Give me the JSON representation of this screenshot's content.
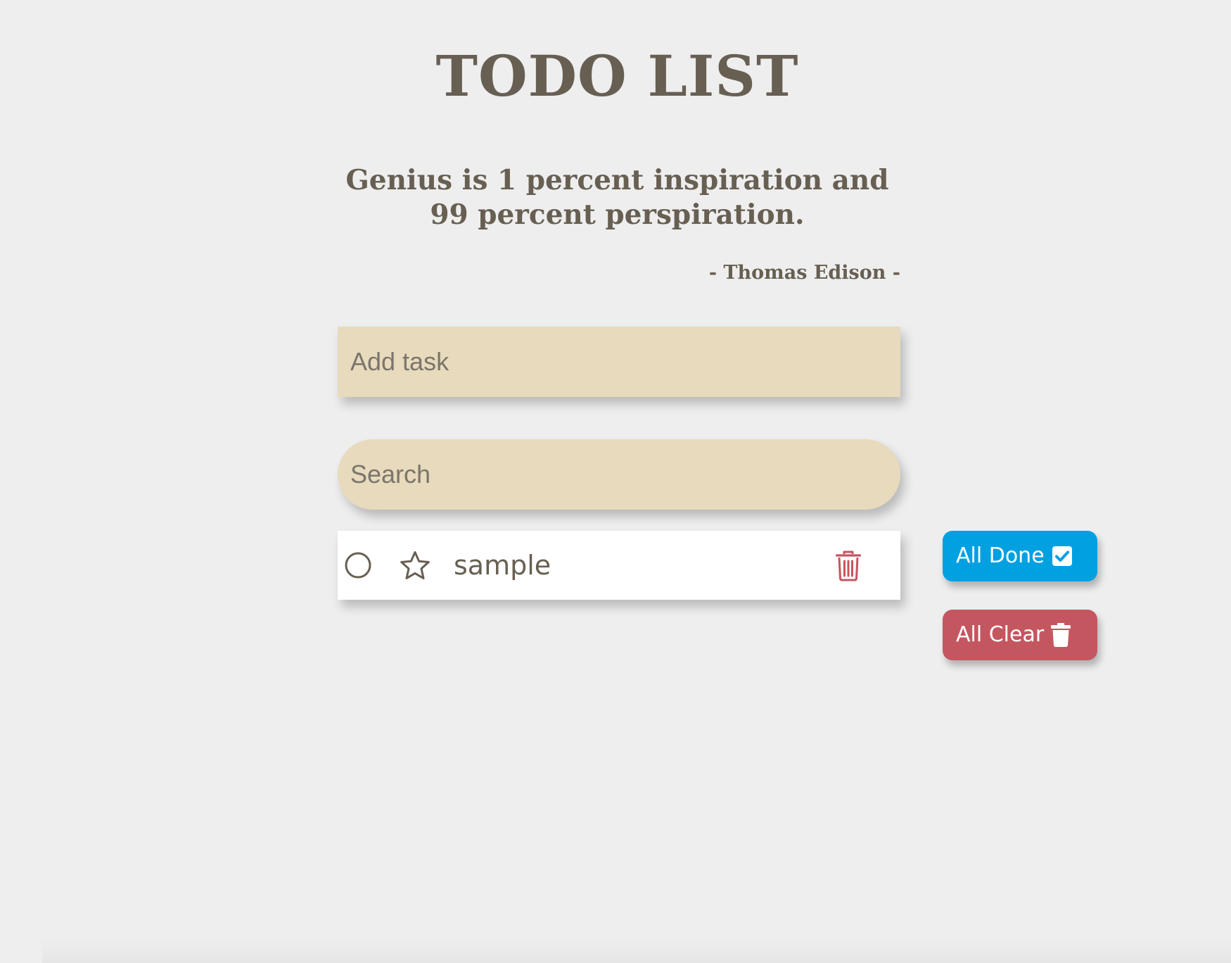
{
  "header": {
    "title": "TODO LIST"
  },
  "quote": {
    "text": "Genius is 1 percent inspiration and 99 percent perspiration.",
    "author": "- Thomas Edison -"
  },
  "add_task": {
    "placeholder": "Add task",
    "value": ""
  },
  "search": {
    "placeholder": "Search",
    "value": ""
  },
  "tasks": [
    {
      "text": "sample",
      "done": false,
      "starred": false
    }
  ],
  "actions": {
    "all_done_label": "All Done",
    "all_clear_label": "All Clear"
  },
  "colors": {
    "background": "#eeeeee",
    "text": "#675f52",
    "field": "#e8dabc",
    "all_done": "#00a0e1",
    "all_clear": "#c45660",
    "delete_icon": "#c45660"
  },
  "icons": {
    "task_check": "circle-outline-icon",
    "task_star": "star-outline-icon",
    "task_delete": "trash-outline-icon",
    "all_done": "checkbox-checked-icon",
    "all_clear": "trash-filled-icon"
  }
}
